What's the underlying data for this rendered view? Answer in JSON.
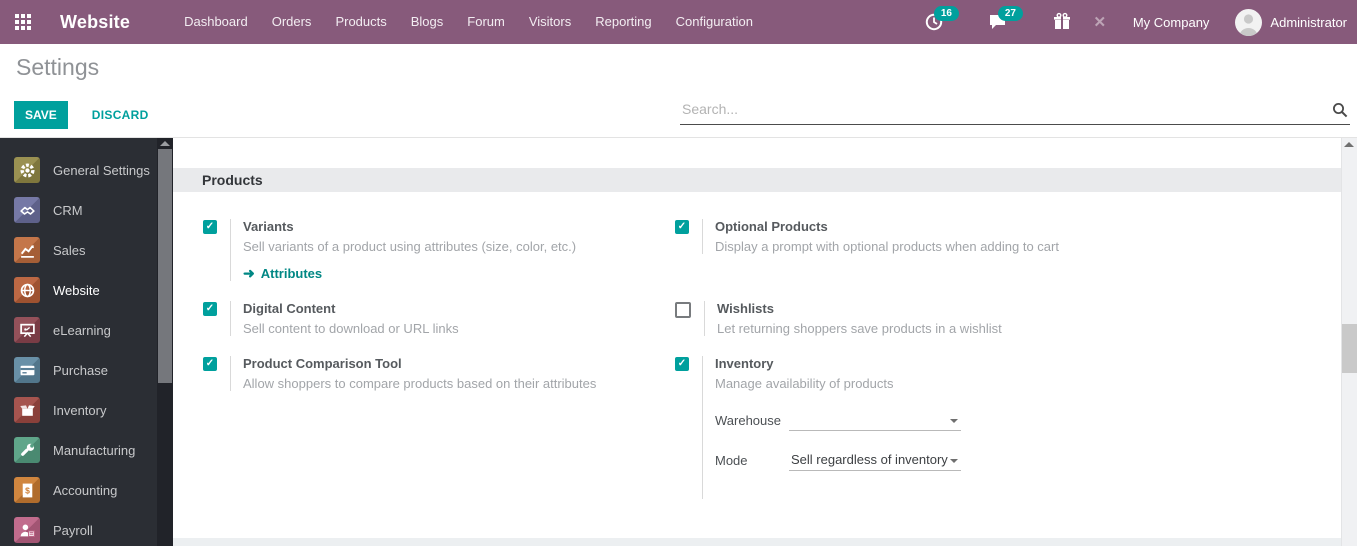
{
  "colors": {
    "brand_purple": "#875A7B",
    "accent_teal": "#00A09D",
    "link_teal": "#008784",
    "sidebar_bg": "#2b2e34"
  },
  "topbar": {
    "app_name": "Website",
    "menu": [
      "Dashboard",
      "Orders",
      "Products",
      "Blogs",
      "Forum",
      "Visitors",
      "Reporting",
      "Configuration"
    ],
    "activities_badge": "16",
    "messages_badge": "27",
    "company": "My Company",
    "user": "Administrator"
  },
  "control_panel": {
    "title": "Settings",
    "save_label": "SAVE",
    "discard_label": "DISCARD",
    "search_placeholder": "Search..."
  },
  "sidebar": {
    "items": [
      {
        "label": "General Settings",
        "icon": "gear-icon",
        "color": "#948a47",
        "active": false
      },
      {
        "label": "CRM",
        "icon": "handshake-icon",
        "color": "#6d71a0",
        "active": false
      },
      {
        "label": "Sales",
        "icon": "sales-chart-icon",
        "color": "#c06e3f",
        "active": false
      },
      {
        "label": "Website",
        "icon": "globe-icon",
        "color": "#b85f38",
        "active": true
      },
      {
        "label": "eLearning",
        "icon": "presentation-icon",
        "color": "#8d4650",
        "active": false
      },
      {
        "label": "Purchase",
        "icon": "credit-card-icon",
        "color": "#6089a2",
        "active": false
      },
      {
        "label": "Inventory",
        "icon": "box-icon",
        "color": "#a04a44",
        "active": false
      },
      {
        "label": "Manufacturing",
        "icon": "wrench-icon",
        "color": "#56a083",
        "active": false
      },
      {
        "label": "Accounting",
        "icon": "invoice-icon",
        "color": "#cd7e33",
        "active": false
      },
      {
        "label": "Payroll",
        "icon": "payroll-icon",
        "color": "#bd6386",
        "active": false
      }
    ]
  },
  "content": {
    "section_title": "Products",
    "columns": {
      "left": [
        {
          "label": "Variants",
          "desc": "Sell variants of a product using attributes (size, color, etc.)",
          "checked": true,
          "link": "Attributes"
        },
        {
          "label": "Digital Content",
          "desc": "Sell content to download or URL links",
          "checked": true
        },
        {
          "label": "Product Comparison Tool",
          "desc": "Allow shoppers to compare products based on their attributes",
          "checked": true
        }
      ],
      "right": [
        {
          "label": "Optional Products",
          "desc": "Display a prompt with optional products when adding to cart",
          "checked": true
        },
        {
          "label": "Wishlists",
          "desc": "Let returning shoppers save products in a wishlist",
          "checked": false
        },
        {
          "label": "Inventory",
          "desc": "Manage availability of products",
          "checked": true,
          "fields": [
            {
              "label": "Warehouse",
              "value": ""
            },
            {
              "label": "Mode",
              "value": "Sell regardless of inventory"
            }
          ]
        }
      ]
    }
  }
}
